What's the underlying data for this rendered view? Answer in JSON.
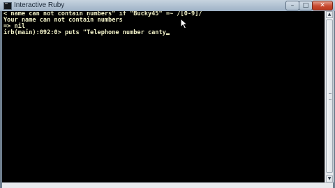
{
  "window": {
    "title": "Interactive Ruby",
    "controls": {
      "minimize": "–",
      "maximize": "□",
      "close": "✕"
    }
  },
  "console": {
    "lines": [
      "< name can not contain numbers\" if \"Bucky45\" =~ /[0-9]/",
      "Your name can not contain numbers",
      "=> nil",
      "irb(main):092:0> puts \"Telephone number canty"
    ],
    "text_color": "#f2f2c8",
    "background_color": "#000000"
  },
  "scrollbar": {
    "up_arrow": "▲",
    "down_arrow": "▼"
  },
  "icons": {
    "app": "console-window-icon",
    "pointer": "mouse-pointer-icon"
  }
}
